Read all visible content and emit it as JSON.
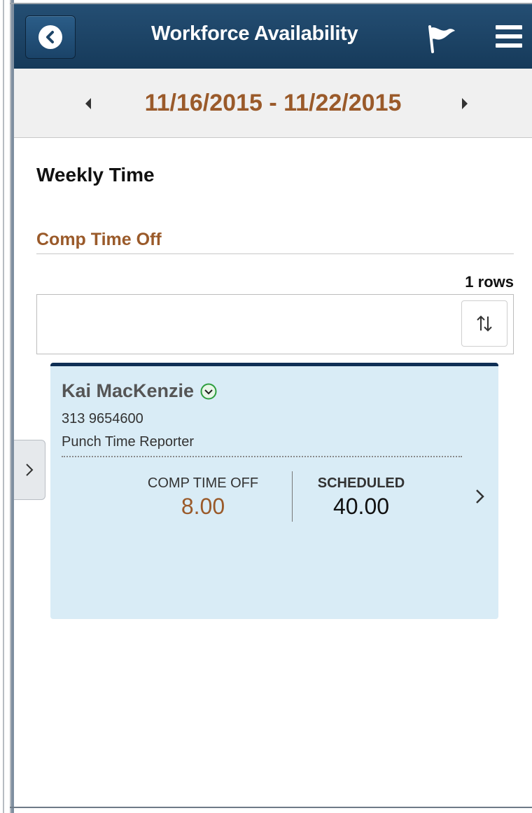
{
  "header": {
    "title": "Workforce Availability",
    "back_icon": "back-arrow-icon",
    "flag_icon": "flag-icon",
    "menu_icon": "hamburger-menu-icon"
  },
  "date_nav": {
    "range": "11/16/2015 - 11/22/2015",
    "prev_icon": "triangle-left-icon",
    "next_icon": "triangle-right-icon"
  },
  "page": {
    "title": "Weekly Time",
    "section_title": "Comp Time Off",
    "row_count": "1 rows"
  },
  "toolbar": {
    "sort_icon": "sort-up-down-icon"
  },
  "card": {
    "name": "Kai MacKenzie",
    "phone": "313 9654600",
    "role": "Punch Time Reporter",
    "metrics": [
      {
        "label": "COMP TIME OFF",
        "value": "8.00"
      },
      {
        "label": "SCHEDULED",
        "value": "40.00"
      }
    ]
  },
  "colors": {
    "header_bg": "#1e4568",
    "accent_brown": "#9a5a2a",
    "card_bg": "#d9ecf6",
    "card_border": "#0f2f55",
    "expand_green": "#2e9e3e"
  }
}
